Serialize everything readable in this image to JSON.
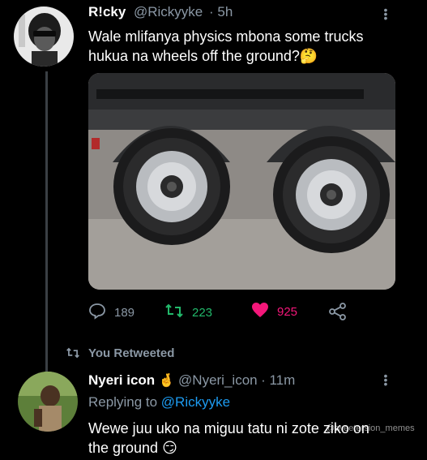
{
  "tweet": {
    "display_name": "R!cky",
    "handle": "@Rickyyke",
    "time": "· 5h",
    "text_line1": "Wale mlifanya physics mbona some trucks",
    "text_line2": "hukua na wheels off the ground?",
    "text_emoji": "🤔",
    "counts": {
      "replies": "189",
      "retweets": "223",
      "likes": "925"
    },
    "icons": {
      "reply": "reply-icon",
      "retweet": "retweet-icon",
      "like": "heart-icon",
      "share": "share-icon",
      "more": "more-dots-icon"
    }
  },
  "retweet_banner": {
    "label": "You Retweeted"
  },
  "reply": {
    "display_name": "Nyeri icon",
    "name_emoji": "🤞",
    "handle": "@Nyeri_icon",
    "time": "· 11m",
    "replying_prefix": "Replying to",
    "replying_handle": "@Rickyyke",
    "text_line1": "Wewe juu uko na miguu tatu ni zote ziko on",
    "text_line2": "the ground",
    "text_emoji": "😏"
  },
  "watermark": "@tweetersion_memes",
  "colors": {
    "background": "#000000",
    "accent_blue": "#1d9bf0",
    "retweet_green": "#22b96b",
    "like_pink": "#f4177a",
    "muted": "#8b98a5"
  }
}
